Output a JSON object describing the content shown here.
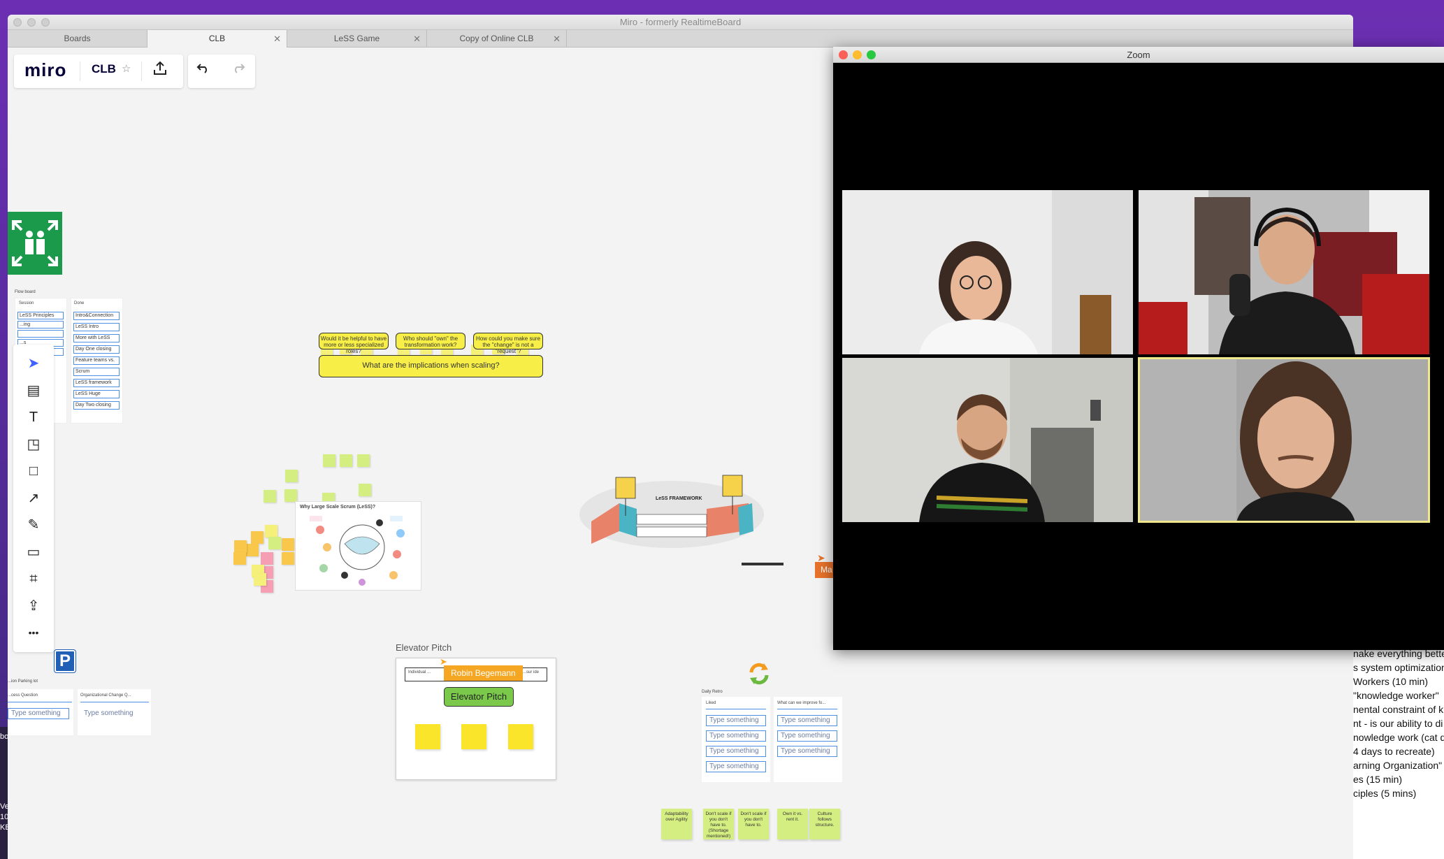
{
  "desktop": {
    "right_text_lines": [
      "nake everything bette",
      "s system optimization",
      "Workers (10 min)",
      "\"knowledge worker\"",
      "nental constraint of k",
      "nt - is our ability to di",
      "nowledge work (cat d",
      "4 days to recreate)",
      "arning Organization\"",
      "es (15 min)",
      "ciples (5 mins)"
    ],
    "left_edge_text": [
      "bo",
      "Ve",
      "10",
      "KB"
    ]
  },
  "miro_window": {
    "title": "Miro - formerly RealtimeBoard",
    "tabs": [
      {
        "label": "Boards",
        "closable": false
      },
      {
        "label": "CLB",
        "closable": true,
        "active": true
      },
      {
        "label": "LeSS Game",
        "closable": true
      },
      {
        "label": "Copy of Online CLB",
        "closable": true
      }
    ],
    "logo": "miro",
    "board_name": "CLB",
    "icons": {
      "star": "star-icon",
      "share": "upload-icon",
      "undo": "undo-icon",
      "redo": "redo-icon"
    }
  },
  "toolbar": {
    "tools": [
      {
        "name": "select-tool",
        "glyph": "➤"
      },
      {
        "name": "templates-tool",
        "glyph": "▤"
      },
      {
        "name": "text-tool",
        "glyph": "T"
      },
      {
        "name": "sticky-note-tool",
        "glyph": "◳"
      },
      {
        "name": "shape-tool",
        "glyph": "□"
      },
      {
        "name": "arrow-tool",
        "glyph": "↗"
      },
      {
        "name": "pen-tool",
        "glyph": "✎"
      },
      {
        "name": "comment-tool",
        "glyph": "▭"
      },
      {
        "name": "frame-tool",
        "glyph": "⌗"
      },
      {
        "name": "upload-tool",
        "glyph": "⇪"
      },
      {
        "name": "more-tool",
        "glyph": "•••"
      }
    ]
  },
  "board": {
    "flow_board": {
      "title": "Flow board",
      "col1_header": "Session",
      "col2_header": "Done",
      "col1_items": [
        "LeSS Principles",
        "...ing",
        "",
        "...s",
        ""
      ],
      "col2_items": [
        "Intro&Connection",
        "LeSS Intro",
        "More with LeSS",
        "Day One closing",
        "Feature teams vs.",
        "Scrum",
        "LeSS framework",
        "LeSS Huge",
        "Day Two closing"
      ]
    },
    "implications": {
      "question1": "Would it be helpful to have more or less specialized roles?",
      "question2": "Who should \"own\" the transformation work?",
      "question3": "How could you make sure the \"change\" is not a \"request\"?",
      "main": "What are the implications when scaling?"
    },
    "why_less": {
      "title": "Why Large Scale Scrum (LeSS)?"
    },
    "less_framework": {
      "title": "LeSS FRAMEWORK"
    },
    "cursor_label": "Ma",
    "parking_lot": {
      "title": "...ion Parking lot",
      "col1_header": "...cess Question",
      "col2_header": "Organizational Change Q...",
      "placeholder": "Type something"
    },
    "elevator": {
      "label": "Elevator Pitch",
      "input_text": "Individual ...",
      "input_suffix": "...sur ide",
      "cursor_name": "Robin Begemann",
      "bubble": "Elevator Pitch"
    },
    "daily_retro": {
      "title": "Daily Retro",
      "col1_header": "Liked",
      "col2_header": "What can we improve fo...",
      "placeholder": "Type something"
    },
    "bottom_stickies": [
      "Adaptability over Agility",
      "Don't scale if you don't have to. (Shortage mentioned!)",
      "Don't scale if you don't have to.",
      "Own it vs. rent it.",
      "Culture follows structure."
    ]
  },
  "zoom_window": {
    "title": "Zoom",
    "participants": [
      {
        "name": "participant-1"
      },
      {
        "name": "participant-2"
      },
      {
        "name": "participant-3"
      },
      {
        "name": "participant-4",
        "speaking": true
      }
    ],
    "highlight_color": "#f0e68c"
  }
}
